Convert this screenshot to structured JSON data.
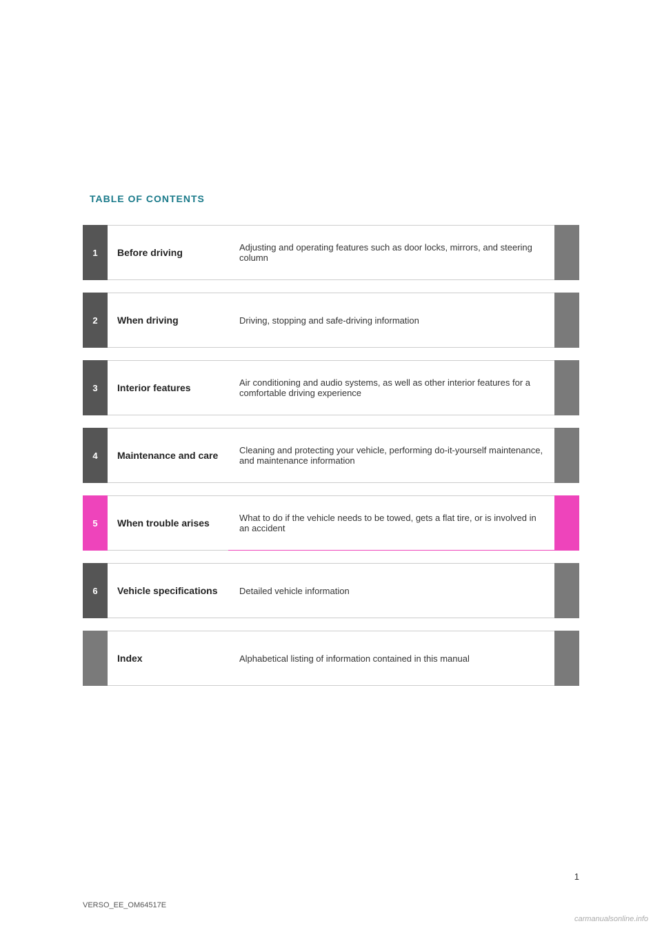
{
  "page": {
    "title": "TABLE OF CONTENTS",
    "footer_page_number": "1",
    "footer_label": "VERSO_EE_OM64517E",
    "watermark": "carmanualsonline.info"
  },
  "toc": {
    "rows": [
      {
        "number": "1",
        "name": "Before driving",
        "description": "Adjusting and operating features such as door locks, mirrors, and steering column",
        "highlight": false,
        "has_number": true
      },
      {
        "number": "2",
        "name": "When driving",
        "description": "Driving, stopping and safe-driving information",
        "highlight": false,
        "has_number": true
      },
      {
        "number": "3",
        "name": "Interior features",
        "description": "Air conditioning and audio systems, as well as other interior features for a comfortable driving experience",
        "highlight": false,
        "has_number": true
      },
      {
        "number": "4",
        "name": "Maintenance and care",
        "description": "Cleaning and protecting your vehicle, performing do-it-yourself maintenance, and maintenance information",
        "highlight": false,
        "has_number": true
      },
      {
        "number": "5",
        "name": "When trouble arises",
        "description": "What to do if the vehicle needs to be towed, gets a flat tire, or is involved in an accident",
        "highlight": true,
        "has_number": true
      },
      {
        "number": "6",
        "name": "Vehicle specifications",
        "description": "Detailed vehicle information",
        "highlight": false,
        "has_number": true
      },
      {
        "number": "",
        "name": "Index",
        "description": "Alphabetical listing of information contained in this manual",
        "highlight": false,
        "has_number": false
      }
    ]
  }
}
